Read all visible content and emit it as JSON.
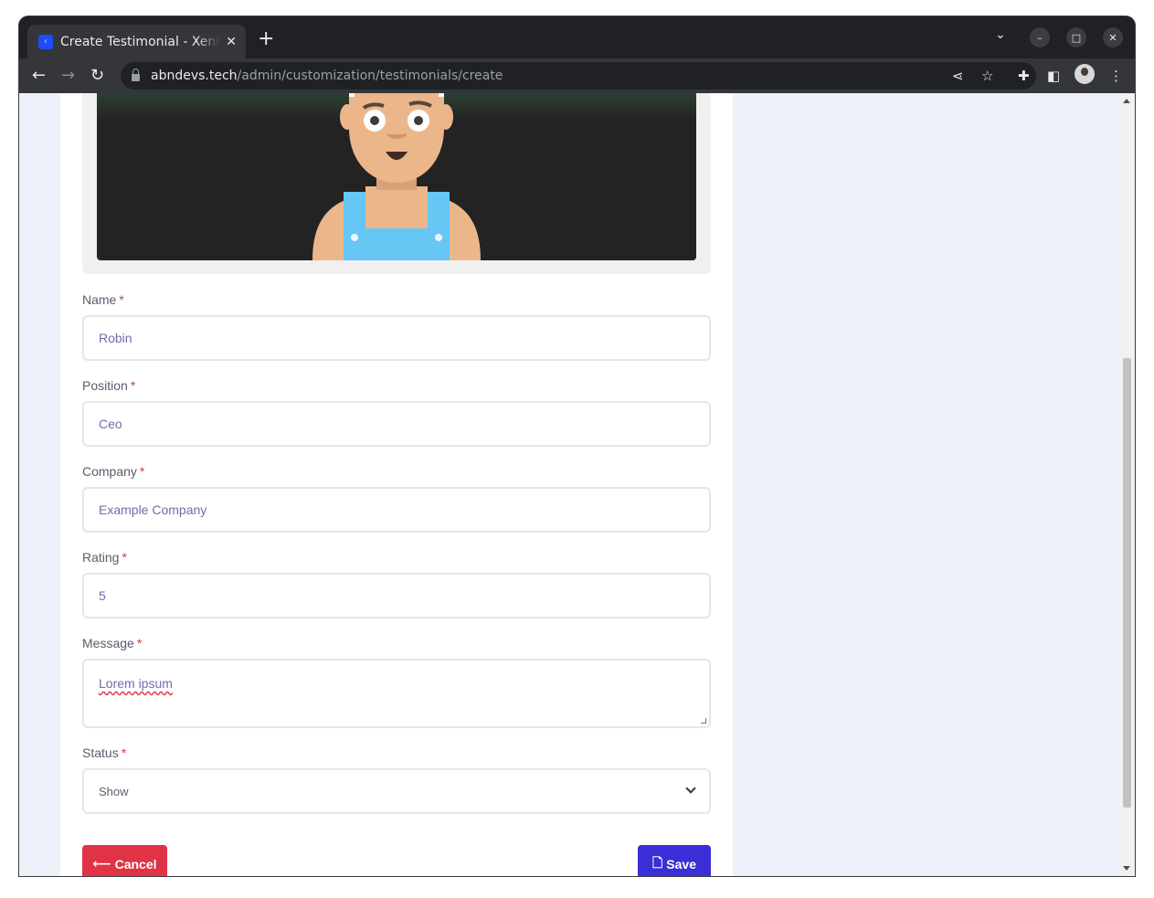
{
  "browser": {
    "tab_title": "Create Testimonial - Xenith",
    "tab_close": "✕",
    "new_tab": "+",
    "url_host": "abndevs.tech",
    "url_path": "/admin/customization/testimonials/create",
    "favicon_glyph": "‹"
  },
  "form": {
    "name": {
      "label": "Name",
      "required": "*",
      "value": "Robin"
    },
    "position": {
      "label": "Position",
      "required": "*",
      "value": "Ceo"
    },
    "company": {
      "label": "Company",
      "required": "*",
      "value": "Example Company"
    },
    "rating": {
      "label": "Rating",
      "required": "*",
      "value": "5"
    },
    "message": {
      "label": "Message",
      "required": "*",
      "value": "Lorem ipsum"
    },
    "status": {
      "label": "Status",
      "required": "*",
      "value": "Show"
    }
  },
  "actions": {
    "cancel_label": "Cancel",
    "save_label": "Save"
  },
  "colors": {
    "cancel": "#e03345",
    "save": "#3a2fd6",
    "page_bg": "#edf1f9",
    "required": "#e03345"
  },
  "icons": {
    "back": "arrow-left-icon",
    "forward": "arrow-right-icon",
    "reload": "reload-icon",
    "share": "share-icon",
    "star": "star-icon",
    "extensions": "puzzle-icon",
    "sidepanel": "side-panel-icon",
    "menu": "kebab-menu-icon",
    "cancel": "arrow-left-icon",
    "save": "file-icon"
  }
}
